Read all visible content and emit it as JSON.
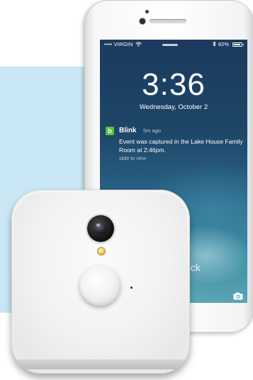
{
  "status_bar": {
    "carrier": "•••• VIRGIN",
    "battery_text": "82%",
    "wifi_icon": "wifi-icon",
    "bluetooth_icon": "bluetooth-icon",
    "battery_icon": "battery-icon"
  },
  "lock_screen": {
    "time": "3:36",
    "date": "Wednesday, October 2",
    "unlock_hint": "ock"
  },
  "notification": {
    "app_icon_letter": "b",
    "app_icon_color": "#5ac23c",
    "app_name": "Blink",
    "time_ago": "5m ago",
    "message": "Event was captured in the Lake House Family Room at 2:46pm.",
    "action_hint": "slide to view"
  },
  "colors": {
    "background_panel": "#c9e7f4"
  },
  "icons": {
    "camera_shortcut": "camera-icon"
  }
}
